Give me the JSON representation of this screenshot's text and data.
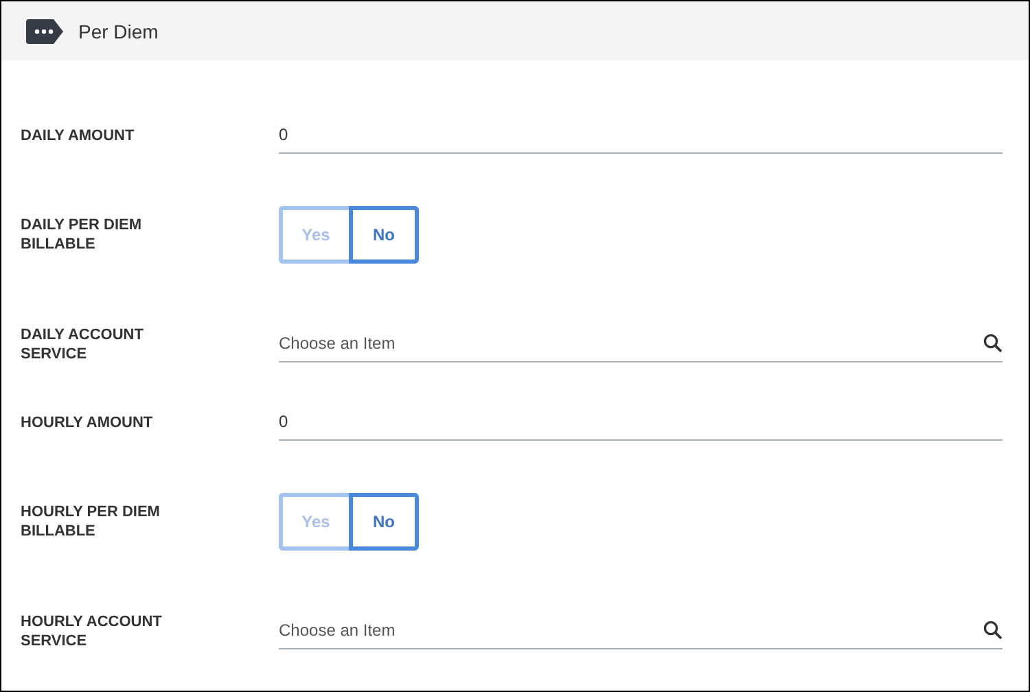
{
  "panel": {
    "title": "Per Diem"
  },
  "fields": [
    {
      "kind": "text",
      "label": "DAILY AMOUNT",
      "value": "0"
    },
    {
      "kind": "toggle",
      "label": "DAILY PER DIEM BILLABLE",
      "options": [
        {
          "label": "Yes",
          "selected": false
        },
        {
          "label": "No",
          "selected": true
        }
      ]
    },
    {
      "kind": "lookup",
      "label": "DAILY ACCOUNT SERVICE",
      "placeholder": "Choose an Item"
    },
    {
      "kind": "text",
      "label": "HOURLY AMOUNT",
      "value": "0"
    },
    {
      "kind": "toggle",
      "label": "HOURLY PER DIEM BILLABLE",
      "options": [
        {
          "label": "Yes",
          "selected": false
        },
        {
          "label": "No",
          "selected": true
        }
      ]
    },
    {
      "kind": "lookup",
      "label": "HOURLY ACCOUNT SERVICE",
      "placeholder": "Choose an Item"
    }
  ]
}
